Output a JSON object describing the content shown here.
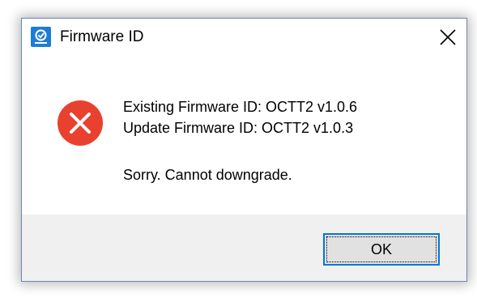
{
  "window": {
    "title": "Firmware ID",
    "app_icon": "app-logo-icon",
    "close_icon": "close-icon"
  },
  "message": {
    "icon": "error-icon",
    "icon_color": "#e9412f",
    "existing_line": "Existing Firmware ID: OCTT2 v1.0.6",
    "update_line": "Update Firmware ID: OCTT2 v1.0.3",
    "error_line": "Sorry. Cannot downgrade."
  },
  "buttons": {
    "ok_label": "OK",
    "accent": "#0078d7"
  }
}
